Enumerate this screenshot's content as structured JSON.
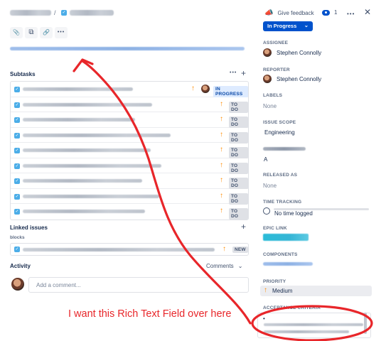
{
  "header": {
    "slash": "/",
    "give_feedback": "Give feedback",
    "watch_count": "1",
    "more": "•••",
    "close": "✕"
  },
  "toolbar": {
    "attach": "📎",
    "subtask": "⧉",
    "link": "🔗",
    "more": "•••"
  },
  "subtasks": {
    "title": "Subtasks",
    "more": "•••",
    "add": "+",
    "rows": [
      {
        "status": "IN PROGRESS"
      },
      {
        "status": "TO DO"
      },
      {
        "status": "TO DO"
      },
      {
        "status": "TO DO"
      },
      {
        "status": "TO DO"
      },
      {
        "status": "TO DO"
      },
      {
        "status": "TO DO"
      },
      {
        "status": "TO DO"
      },
      {
        "status": "TO DO"
      }
    ]
  },
  "linked": {
    "title": "Linked issues",
    "add": "+",
    "relation": "blocks",
    "item_status": "NEW"
  },
  "activity": {
    "title": "Activity",
    "filter": "Comments",
    "placeholder": "Add a comment..."
  },
  "sidebar": {
    "status_button": "In Progress",
    "assignee_label": "ASSIGNEE",
    "assignee": "Stephen Connolly",
    "reporter_label": "REPORTER",
    "reporter": "Stephen Connolly",
    "labels_label": "LABELS",
    "labels_value": "None",
    "scope_label": "ISSUE SCOPE",
    "scope_value": "Engineering",
    "unknown_value": "A",
    "released_label": "RELEASED AS",
    "released_value": "None",
    "time_label": "TIME TRACKING",
    "time_value": "No time logged",
    "epic_label": "EPIC LINK",
    "components_label": "COMPONENTS",
    "priority_label": "PRIORITY",
    "priority_value": "Medium",
    "acceptance_label": "ACCEPTANCE CRITERIA"
  },
  "annotation": {
    "text": "I want this Rich Text Field over here"
  },
  "colors": {
    "annotation": "#e8262a",
    "accent": "#0052cc",
    "priority": "#ff8b00"
  }
}
